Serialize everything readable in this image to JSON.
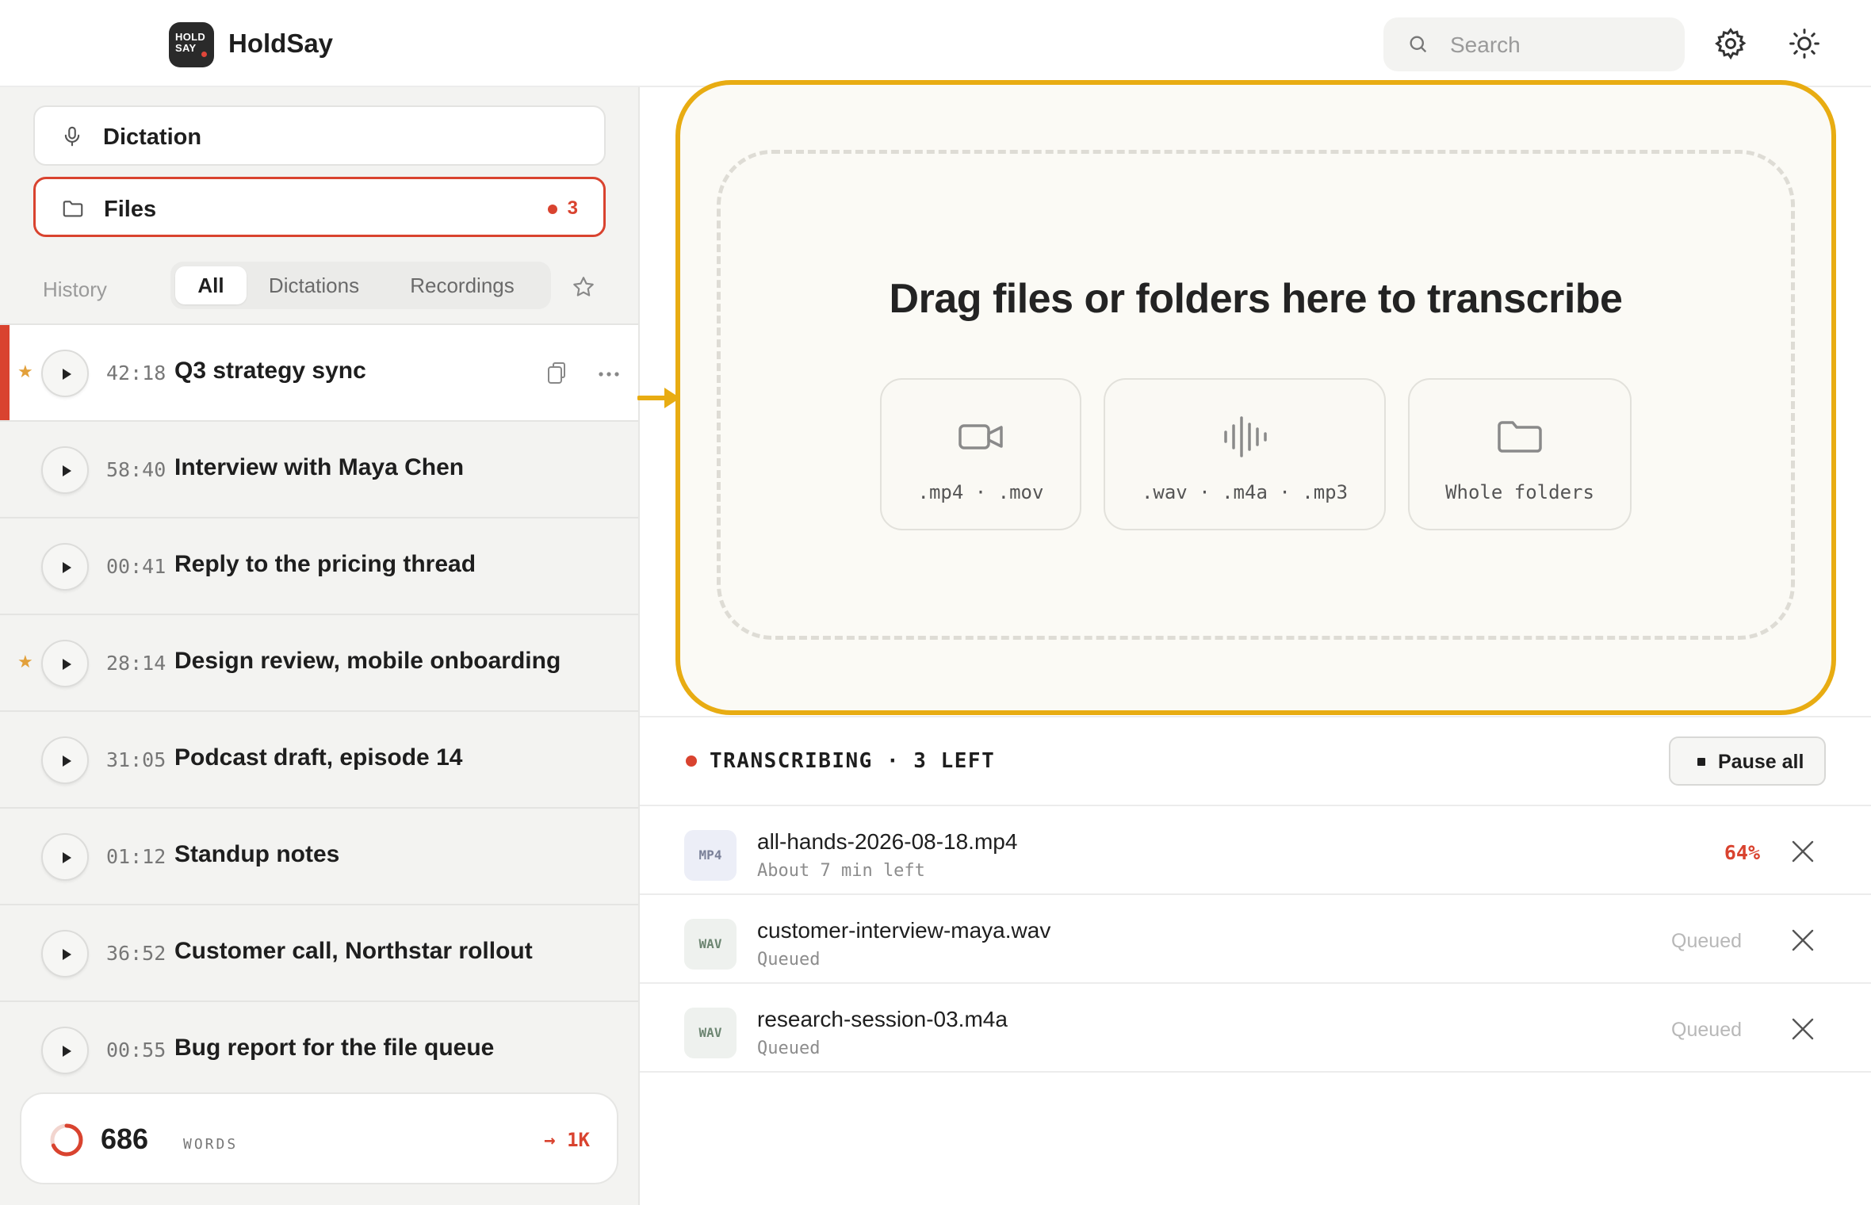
{
  "header": {
    "logo_text": "HOLD SAY",
    "app_name": "HoldSay",
    "search_placeholder": "Search"
  },
  "sidebar": {
    "nav": [
      {
        "label": "Dictation",
        "icon": "microphone-icon"
      },
      {
        "label": "Files",
        "icon": "folder-icon",
        "badge": "3",
        "active": true
      }
    ],
    "history_label": "History",
    "filters": [
      "All",
      "Dictations",
      "Recordings"
    ],
    "selected_filter": "All",
    "items": [
      {
        "duration": "42:18",
        "title": "Q3 strategy sync",
        "starred": true,
        "selected": true
      },
      {
        "duration": "58:40",
        "title": "Interview with Maya Chen",
        "starred": false
      },
      {
        "duration": "00:41",
        "title": "Reply to the pricing thread",
        "starred": false
      },
      {
        "duration": "28:14",
        "title": "Design review, mobile onboarding",
        "starred": true
      },
      {
        "duration": "31:05",
        "title": "Podcast draft, episode 14",
        "starred": false
      },
      {
        "duration": "01:12",
        "title": "Standup notes",
        "starred": false
      },
      {
        "duration": "36:52",
        "title": "Customer call, Northstar rollout",
        "starred": false
      },
      {
        "duration": "00:55",
        "title": "Bug report for the file queue",
        "starred": false
      }
    ],
    "words": {
      "count": "686",
      "unit": "WORDS",
      "goal": "→ 1K",
      "progress": 0.686
    }
  },
  "dropzone": {
    "headline": "Drag files or folders here to transcribe",
    "cards": [
      {
        "label": ".mp4 · .mov",
        "icon": "video-camera-icon"
      },
      {
        "label": ".wav · .m4a · .mp3",
        "icon": "audio-waveform-icon"
      },
      {
        "label": "Whole folders",
        "icon": "folder-icon"
      }
    ]
  },
  "queue": {
    "status": "TRANSCRIBING · 3 LEFT",
    "pause_label": "Pause all",
    "items": [
      {
        "tag": "MP4",
        "name": "all-hands-2026-08-18.mp4",
        "sub": "About 7 min left",
        "status": "64%"
      },
      {
        "tag": "WAV",
        "name": "customer-interview-maya.wav",
        "sub": "Queued",
        "status": "Queued"
      },
      {
        "tag": "WAV",
        "name": "research-session-03.m4a",
        "sub": "Queued",
        "status": "Queued"
      }
    ]
  },
  "colors": {
    "accent": "#d9432f",
    "highlight": "#e8ac12",
    "star": "#e2a03a"
  }
}
